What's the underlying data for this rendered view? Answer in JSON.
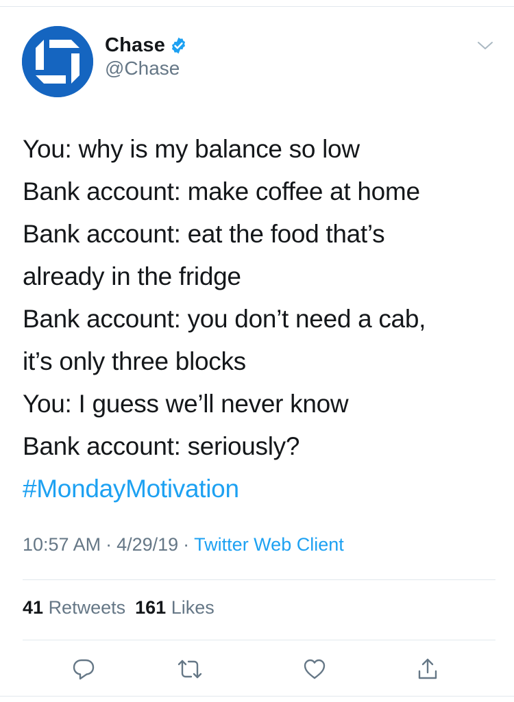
{
  "tweet": {
    "author": {
      "name": "Chase",
      "handle": "@Chase",
      "verified": true,
      "avatar_icon": "chase-octagon-logo",
      "avatar_color": "#1565c0"
    },
    "text_lines": [
      "You: why is my balance so low",
      "Bank account: make coffee at home",
      "Bank account: eat the food that’s",
      "already in the fridge",
      "Bank account: you don’t need a cab,",
      "it’s only three blocks",
      "You: I guess we’ll never know",
      "Bank account: seriously?"
    ],
    "hashtag": "#MondayMotivation",
    "time": "10:57 AM",
    "date": "4/29/19",
    "separator": "·",
    "source": "Twitter Web Client",
    "stats": {
      "retweets_count": "41",
      "retweets_label": "Retweets",
      "likes_count": "161",
      "likes_label": "Likes"
    },
    "actions": [
      "reply-icon",
      "retweet-icon",
      "like-icon",
      "share-icon"
    ],
    "colors": {
      "link": "#1da1f2",
      "text": "#14171a",
      "muted": "#657786",
      "divider": "#e1e8ed"
    }
  }
}
